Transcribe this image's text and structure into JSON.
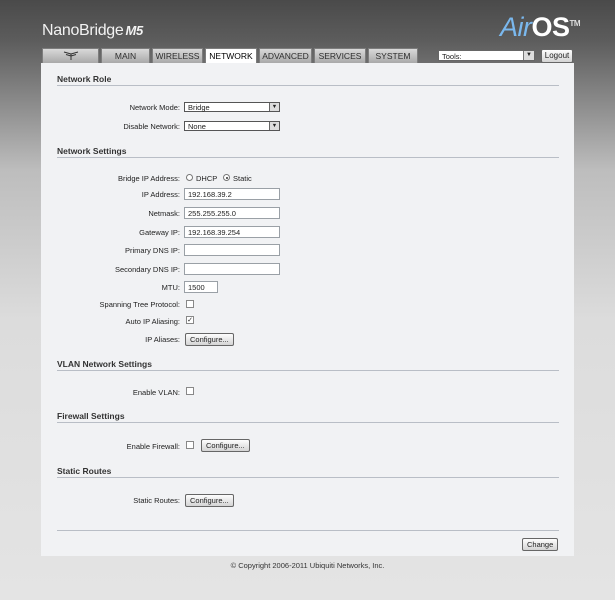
{
  "header": {
    "brand_name": "NanoBridge",
    "brand_model": "M5",
    "airos_air": "Air",
    "airos_os": "OS",
    "airos_tm": "TM"
  },
  "tabs": [
    {
      "label": "MAIN"
    },
    {
      "label": "WIRELESS"
    },
    {
      "label": "NETWORK",
      "active": true
    },
    {
      "label": "ADVANCED"
    },
    {
      "label": "SERVICES"
    },
    {
      "label": "SYSTEM"
    }
  ],
  "toolbar": {
    "tools_value": "Tools:",
    "logout_label": "Logout"
  },
  "network_role": {
    "title": "Network Role",
    "network_mode_label": "Network Mode:",
    "network_mode_value": "Bridge",
    "disable_network_label": "Disable Network:",
    "disable_network_value": "None"
  },
  "network_settings": {
    "title": "Network Settings",
    "bridge_ip_label": "Bridge IP Address:",
    "dhcp_label": "DHCP",
    "static_label": "Static",
    "ip_label": "IP Address:",
    "ip_value": "192.168.39.2",
    "netmask_label": "Netmask:",
    "netmask_value": "255.255.255.0",
    "gateway_label": "Gateway IP:",
    "gateway_value": "192.168.39.254",
    "primary_dns_label": "Primary DNS IP:",
    "primary_dns_value": "",
    "secondary_dns_label": "Secondary DNS IP:",
    "secondary_dns_value": "",
    "mtu_label": "MTU:",
    "mtu_value": "1500",
    "stp_label": "Spanning Tree Protocol:",
    "auto_ip_label": "Auto IP Aliasing:",
    "auto_ip_check": "✓",
    "ip_aliases_label": "IP Aliases:",
    "configure_label": "Configure..."
  },
  "vlan": {
    "title": "VLAN Network Settings",
    "enable_label": "Enable VLAN:"
  },
  "firewall": {
    "title": "Firewall Settings",
    "enable_label": "Enable Firewall:",
    "configure_label": "Configure..."
  },
  "static_routes": {
    "title": "Static Routes",
    "label": "Static Routes:",
    "configure_label": "Configure..."
  },
  "actions": {
    "change_label": "Change"
  },
  "footer": {
    "copyright": "© Copyright 2006-2011 Ubiquiti Networks, Inc."
  }
}
